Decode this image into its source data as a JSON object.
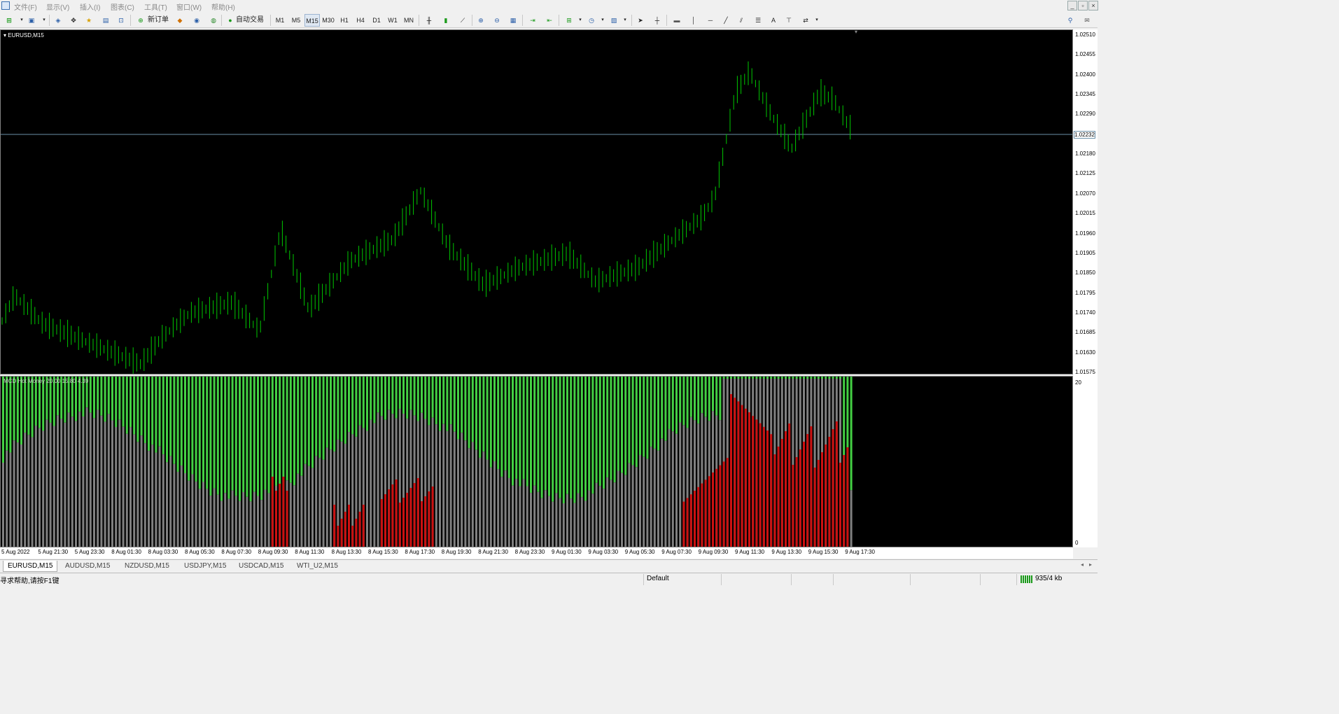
{
  "menu": {
    "items": [
      "文件(F)",
      "显示(V)",
      "插入(I)",
      "图表(C)",
      "工具(T)",
      "窗口(W)",
      "帮助(H)"
    ]
  },
  "toolbar": {
    "new_order_label": "新订单",
    "auto_trade_label": "自动交易",
    "timeframes": [
      "M1",
      "M5",
      "M15",
      "M30",
      "H1",
      "H4",
      "D1",
      "W1",
      "MN"
    ],
    "active_timeframe": "M15"
  },
  "chart": {
    "symbol_label": "EURUSD,M15",
    "current_price": "1.02232",
    "price_ticks": [
      "1.02510",
      "1.02455",
      "1.02400",
      "1.02345",
      "1.02290",
      "1.02232",
      "1.02180",
      "1.02125",
      "1.02070",
      "1.02015",
      "1.01960",
      "1.01905",
      "1.01850",
      "1.01795",
      "1.01740",
      "1.01685",
      "1.01630",
      "1.01575"
    ],
    "time_ticks": [
      "5 Aug 2022",
      "5 Aug 21:30",
      "5 Aug 23:30",
      "8 Aug 01:30",
      "8 Aug 03:30",
      "8 Aug 05:30",
      "8 Aug 07:30",
      "8 Aug 09:30",
      "8 Aug 11:30",
      "8 Aug 13:30",
      "8 Aug 15:30",
      "8 Aug 17:30",
      "8 Aug 19:30",
      "8 Aug 21:30",
      "8 Aug 23:30",
      "9 Aug 01:30",
      "9 Aug 03:30",
      "9 Aug 05:30",
      "9 Aug 07:30",
      "9 Aug 09:30",
      "9 Aug 11:30",
      "9 Aug 13:30",
      "9 Aug 15:30",
      "9 Aug 17:30"
    ],
    "bull_color": "#00c800",
    "line_color": "#6a8fa8"
  },
  "indicator": {
    "label": "MCD Hot Money 20.00 15.80 4.39",
    "axis_top": "20",
    "axis_bottom": "0",
    "green_color": "#44d044",
    "grey_color": "#808080",
    "red_color": "#cc1010"
  },
  "tabs": [
    "EURUSD,M15",
    "AUDUSD,M15",
    "NZDUSD,M15",
    "USDJPY,M15",
    "USDCAD,M15",
    "WTI_U2,M15"
  ],
  "active_tab": "EURUSD,M15",
  "status": {
    "help_text": "寻求帮助,请按F1键",
    "profile": "Default",
    "traffic": "935/4 kb"
  }
}
